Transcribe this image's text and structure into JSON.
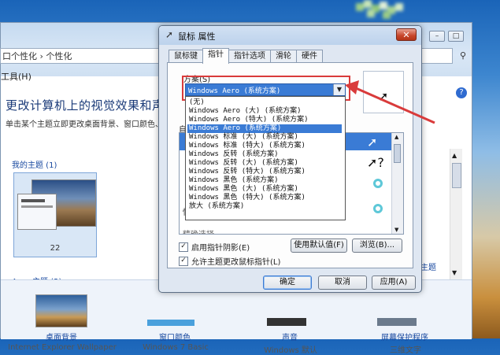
{
  "background_window": {
    "address_path": "口个性化  ›  个性化",
    "menu": "工具(H)",
    "heading": "更改计算机上的视觉效果和声音",
    "subtext": "单击某个主题立即更改桌面背景、窗口颜色、",
    "my_themes_label": "我的主题 (1)",
    "theme_number": "22",
    "aero_themes_label": "Aero 主题 (2)",
    "side_link": "主题",
    "bottom_links": [
      {
        "label": "桌面背景",
        "sub": "Internet Explorer Wallpaper"
      },
      {
        "label": "窗口颜色",
        "sub": "Windows 7 Basic"
      },
      {
        "label": "声音",
        "sub": "Windows 默认"
      },
      {
        "label": "屏幕保护程序",
        "sub": "三维文字"
      }
    ]
  },
  "dialog": {
    "title": "鼠标 属性",
    "close_glyph": "✕",
    "tabs": [
      "鼠标键",
      "指针",
      "指针选项",
      "滑轮",
      "硬件"
    ],
    "active_tab": "指针",
    "scheme_label": "方案(S)",
    "scheme_selected": "Windows Aero (系统方案)",
    "dropdown_items": [
      "(无)",
      "Windows Aero (大) (系统方案)",
      "Windows Aero (特大) (系统方案)",
      "Windows Aero (系统方案)",
      "Windows 标准 (大) (系统方案)",
      "Windows 标准 (特大) (系统方案)",
      "Windows 反转 (系统方案)",
      "Windows 反转 (大) (系统方案)",
      "Windows 反转 (特大) (系统方案)",
      "Windows 黑色 (系统方案)",
      "Windows 黑色 (大) (系统方案)",
      "Windows 黑色 (特大) (系统方案)",
      "放大 (系统方案)"
    ],
    "selected_dropdown_index": 3,
    "custom_label": "自",
    "busy_label": "忙",
    "cut_label": "精确选择",
    "enable_shadow": "启用指针阴影(E)",
    "allow_theme": "允许主题更改鼠标指针(L)",
    "use_default": "使用默认值(F)",
    "browse": "浏览(B)...",
    "ok": "确定",
    "cancel": "取消",
    "apply": "应用(A)",
    "checked_glyph": "✓"
  },
  "colors": {
    "selection": "#3a7bd5",
    "annotation_red": "#d93b3b"
  }
}
